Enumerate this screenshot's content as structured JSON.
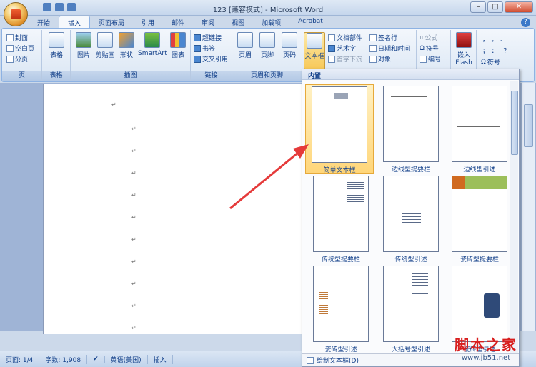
{
  "window": {
    "title": "123 [兼容模式] - Microsoft Word",
    "min": "–",
    "max": "□",
    "close": "✕"
  },
  "tabs": [
    "开始",
    "插入",
    "页面布局",
    "引用",
    "邮件",
    "审阅",
    "视图",
    "加载项",
    "Acrobat"
  ],
  "active_tab": "插入",
  "help": "?",
  "ribbon": {
    "pages": {
      "label": "页",
      "items": [
        "封面",
        "空白页",
        "分页"
      ]
    },
    "tables": {
      "label": "表格",
      "items": [
        "表格"
      ]
    },
    "illustrations": {
      "label": "插图",
      "items": [
        "图片",
        "剪贴画",
        "形状",
        "SmartArt",
        "图表"
      ]
    },
    "links": {
      "label": "链接",
      "items": [
        "超链接",
        "书签",
        "交叉引用"
      ]
    },
    "header_footer": {
      "label": "页眉和页脚",
      "items": [
        "页眉",
        "页脚",
        "页码"
      ]
    },
    "text": {
      "label": "",
      "textbox": "文本框",
      "items": [
        "文档部件",
        "艺术字",
        "首字下沉",
        "签名行",
        "日期和时间",
        "对象"
      ]
    },
    "symbols": {
      "items": [
        "公式",
        "符号",
        "编号",
        "符号"
      ]
    },
    "flash": {
      "label": "嵌入 Flash"
    }
  },
  "gallery": {
    "header": "内置",
    "items": [
      "简单文本框",
      "边线型提要栏",
      "边线型引述",
      "传统型提要栏",
      "传统型引述",
      "瓷砖型提要栏",
      "瓷砖型引述",
      "大括号型引述",
      "瓷砖型引述"
    ],
    "footer": "绘制文本框(D)"
  },
  "document": {
    "paragraph_mark": "↵"
  },
  "status": {
    "page": "页面: 1/4",
    "words": "字数: 1,908",
    "language": "英语(美国)",
    "mode": "插入"
  },
  "watermark": {
    "line1": "脚本之家",
    "line2": "www.jb51.net"
  },
  "colors": {
    "accent": "#15428b",
    "selected": "#f7c95a",
    "arrow": "#e53a3a"
  }
}
